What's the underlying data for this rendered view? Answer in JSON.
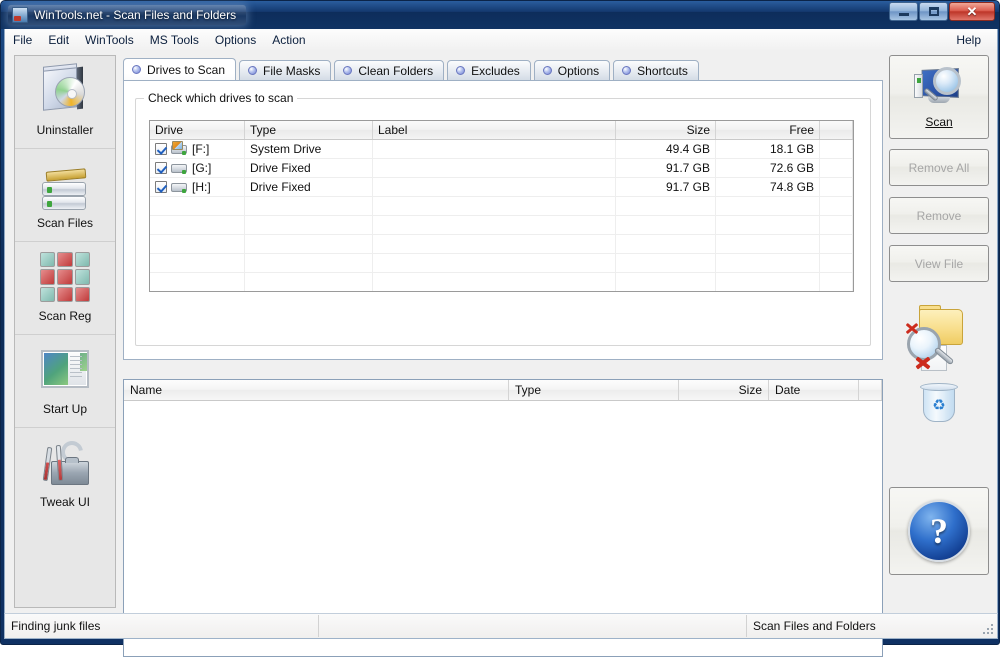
{
  "window": {
    "title": "WinTools.net - Scan Files and Folders",
    "app_icon": "app-icon",
    "buttons": {
      "minimize": "minimize",
      "maximize": "maximize",
      "close": "close"
    }
  },
  "menubar": {
    "items": [
      "File",
      "Edit",
      "WinTools",
      "MS Tools",
      "Options",
      "Action"
    ],
    "help": "Help"
  },
  "sidebar": {
    "items": [
      {
        "label": "Uninstaller",
        "icon": "uninstaller-icon"
      },
      {
        "label": "Scan Files",
        "icon": "scan-files-icon"
      },
      {
        "label": "Scan Reg",
        "icon": "scan-registry-icon"
      },
      {
        "label": "Start Up",
        "icon": "startup-icon"
      },
      {
        "label": "Tweak UI",
        "icon": "tweak-ui-icon"
      }
    ]
  },
  "tabs": [
    {
      "label": "Drives to Scan",
      "active": true
    },
    {
      "label": "File Masks",
      "active": false
    },
    {
      "label": "Clean Folders",
      "active": false
    },
    {
      "label": "Excludes",
      "active": false
    },
    {
      "label": "Options",
      "active": false
    },
    {
      "label": "Shortcuts",
      "active": false
    }
  ],
  "groupbox": {
    "title": "Check which drives to scan"
  },
  "drive_grid": {
    "columns": [
      "Drive",
      "Type",
      "Label",
      "Size",
      "Free",
      ""
    ],
    "rows": [
      {
        "checked": true,
        "icon": "system-drive-icon",
        "drive": "[F:]",
        "type": "System Drive",
        "label": "",
        "size": "49.4 GB",
        "free": "18.1 GB"
      },
      {
        "checked": true,
        "icon": "fixed-drive-icon",
        "drive": "[G:]",
        "type": "Drive Fixed",
        "label": "",
        "size": "91.7 GB",
        "free": "72.6 GB"
      },
      {
        "checked": true,
        "icon": "fixed-drive-icon",
        "drive": "[H:]",
        "type": "Drive Fixed",
        "label": "",
        "size": "91.7 GB",
        "free": "74.8 GB"
      }
    ],
    "empty_rows": 6
  },
  "file_list": {
    "columns": [
      "Name",
      "Type",
      "Size",
      "Date",
      ""
    ],
    "rows": []
  },
  "actions": {
    "scan": {
      "label": "Scan",
      "accelerator": "S",
      "enabled": true,
      "icon": "scan-magnifier-icon"
    },
    "remove_all": {
      "label": "Remove All",
      "accelerator": "A",
      "enabled": false
    },
    "remove": {
      "label": "Remove",
      "accelerator": "R",
      "enabled": false
    },
    "view_file": {
      "label": "View File",
      "accelerator": "V",
      "enabled": false
    },
    "help": {
      "label": "?",
      "icon": "help-question-icon"
    },
    "decorations": [
      {
        "icon": "folder-search-delete-icon"
      },
      {
        "icon": "recycle-bin-icon"
      }
    ]
  },
  "statusbar": {
    "left": "Finding junk files",
    "middle": "",
    "right": "Scan Files and Folders"
  },
  "colors": {
    "titlebar": "#0d2c57",
    "accent": "#2f6fcb",
    "client_bg": "#f0f0f0",
    "disabled_text": "#a6a6a6"
  }
}
